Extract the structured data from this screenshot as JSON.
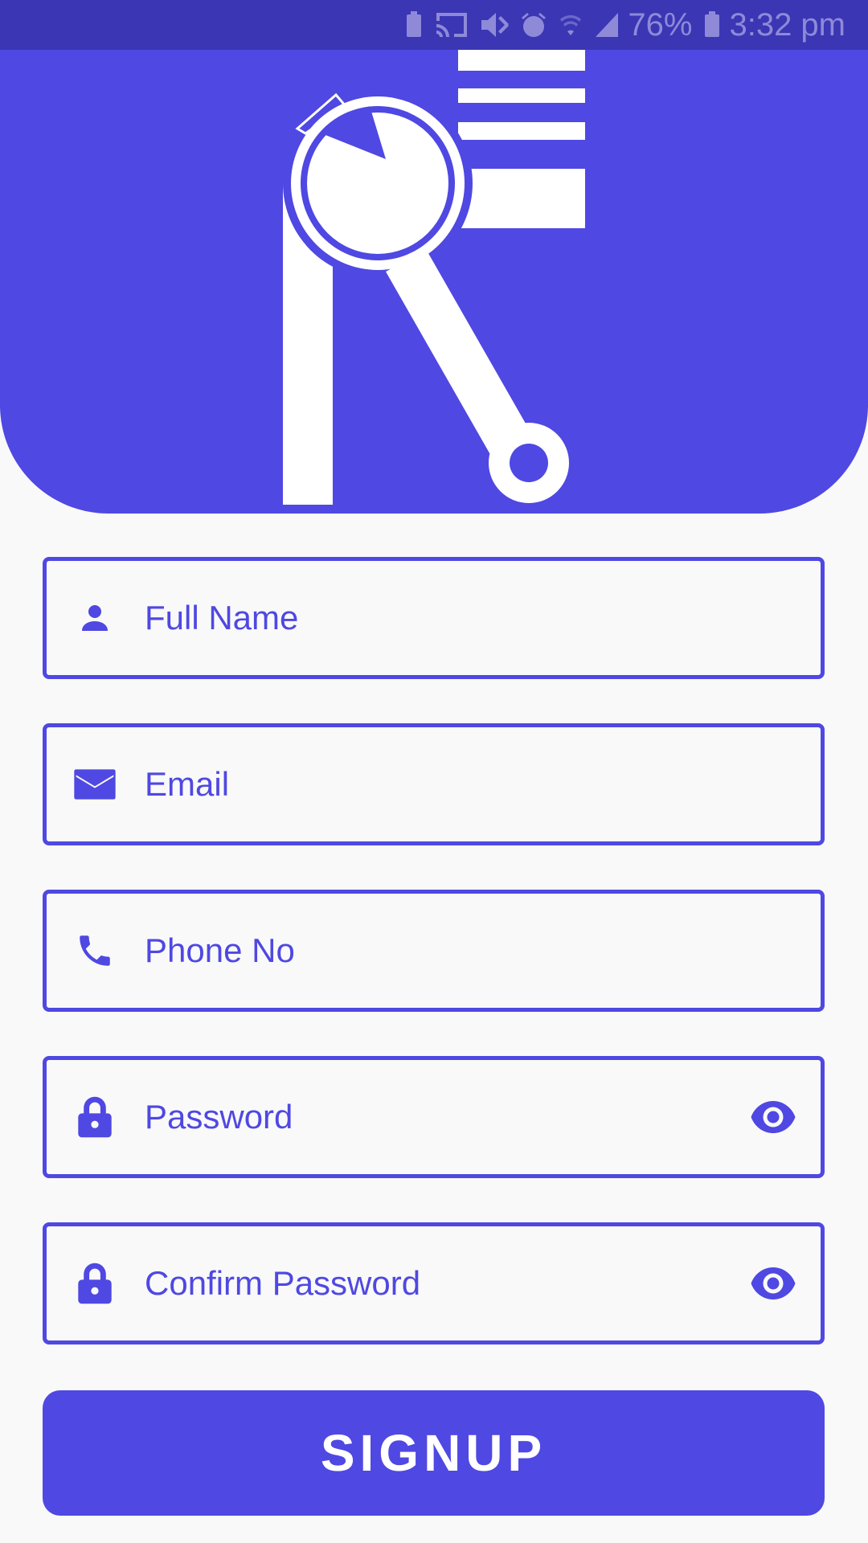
{
  "status_bar": {
    "battery_percent": "76%",
    "time": "3:32 pm",
    "icons": [
      "battery-saver-icon",
      "cast-icon",
      "mute-icon",
      "alarm-icon",
      "wifi-icon",
      "signal-icon",
      "battery-charging-icon"
    ]
  },
  "brand": {
    "logo": "re-wrench-logo",
    "primary_color": "#4f48e2",
    "background_color": "#f9f9f9"
  },
  "form": {
    "full_name": {
      "placeholder": "Full Name",
      "icon": "person-icon"
    },
    "email": {
      "placeholder": "Email",
      "icon": "email-icon"
    },
    "phone": {
      "placeholder": "Phone No",
      "icon": "phone-icon"
    },
    "password": {
      "placeholder": "Password",
      "icon": "lock-icon",
      "toggle_icon": "eye-icon"
    },
    "confirm_password": {
      "placeholder": "Confirm Password",
      "icon": "lock-icon",
      "toggle_icon": "eye-icon"
    }
  },
  "signup": {
    "label": "SIGNUP"
  }
}
